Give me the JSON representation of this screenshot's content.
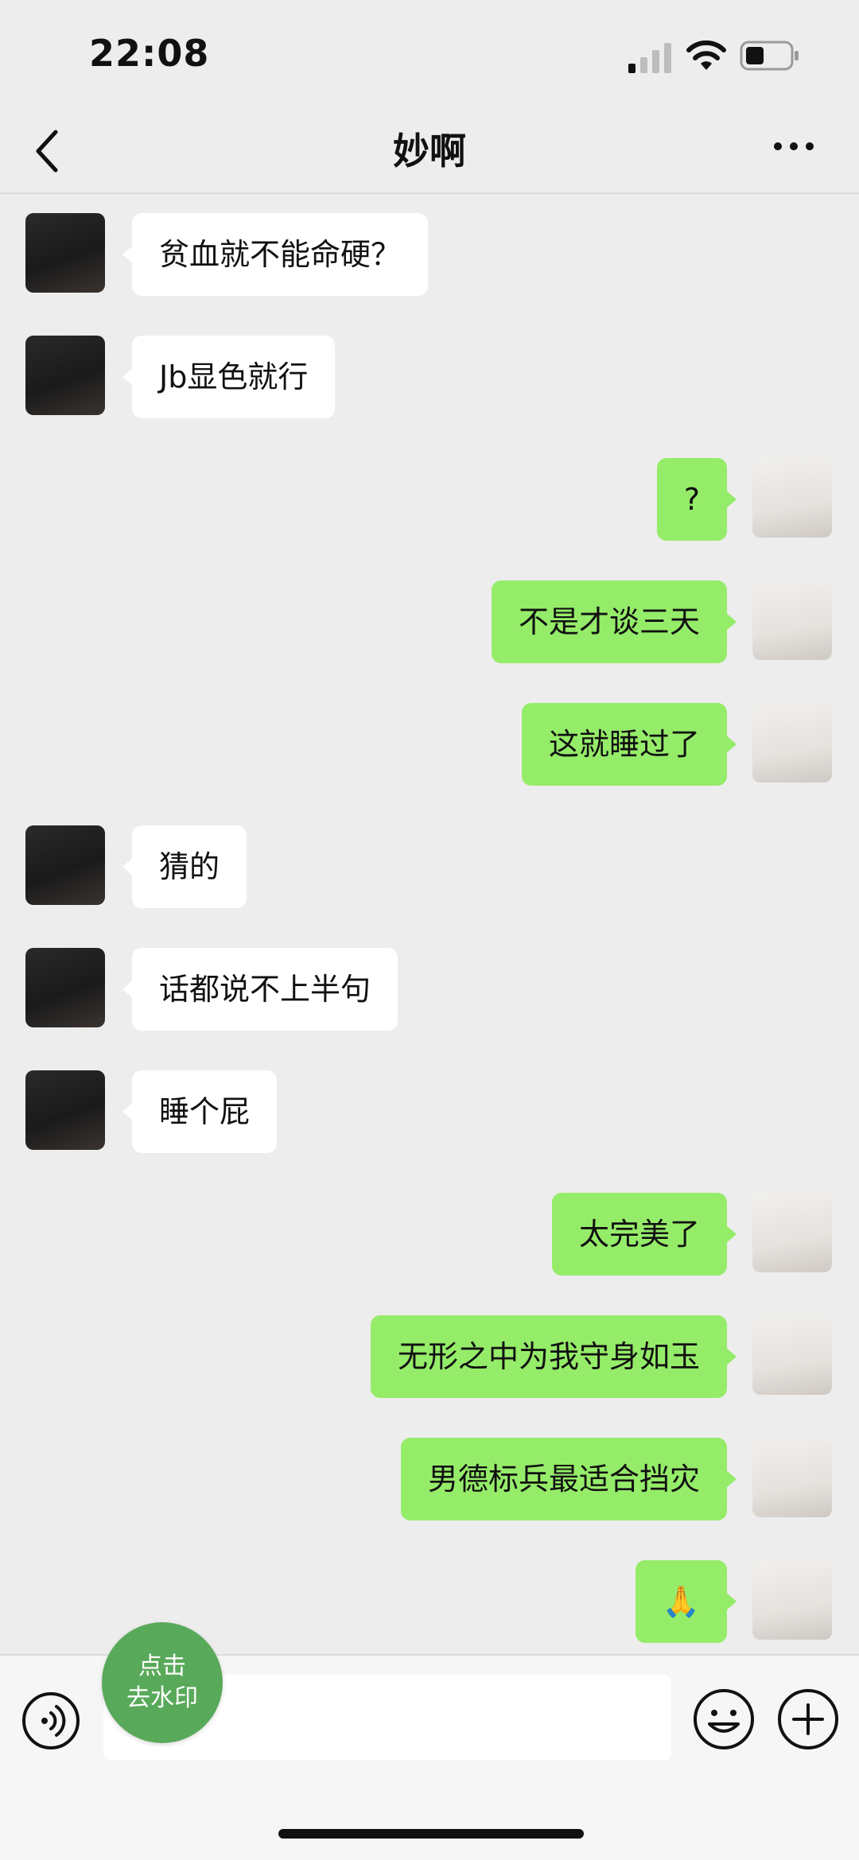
{
  "status_bar": {
    "time": "22:08"
  },
  "header": {
    "title": "妙啊"
  },
  "messages": [
    {
      "side": "left",
      "text": "贫血就不能命硬？"
    },
    {
      "side": "left",
      "text": "Jb显色就行"
    },
    {
      "side": "right",
      "text": "?"
    },
    {
      "side": "right",
      "text": "不是才谈三天"
    },
    {
      "side": "right",
      "text": "这就睡过了"
    },
    {
      "side": "left",
      "text": "猜的"
    },
    {
      "side": "left",
      "text": "话都说不上半句"
    },
    {
      "side": "left",
      "text": "睡个屁"
    },
    {
      "side": "right",
      "text": "太完美了"
    },
    {
      "side": "right",
      "text": "无形之中为我守身如玉"
    },
    {
      "side": "right",
      "text": "男德标兵最适合挡灾"
    },
    {
      "side": "right",
      "text": "🙏"
    }
  ],
  "watermark_button": {
    "line1": "点击",
    "line2": "去水印"
  },
  "colors": {
    "sent_bubble": "#95ec69",
    "received_bubble": "#ffffff",
    "background": "#ededed"
  },
  "icons": [
    "back-chevron-icon",
    "more-dots-icon",
    "voice-icon",
    "emoji-icon",
    "plus-icon",
    "signal-icon",
    "wifi-icon",
    "battery-icon"
  ]
}
